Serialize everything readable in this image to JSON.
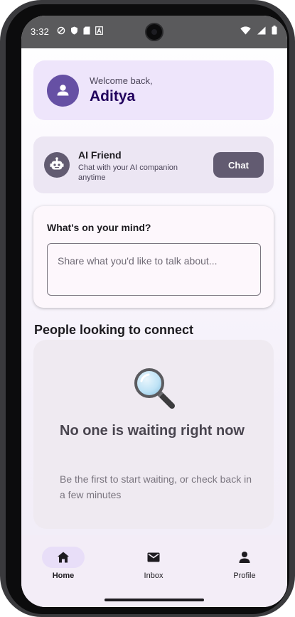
{
  "status_bar": {
    "time": "3:32"
  },
  "welcome": {
    "subtitle": "Welcome back,",
    "name": "Aditya",
    "avatar_icon": "person-icon"
  },
  "ai_friend": {
    "title": "AI Friend",
    "description": "Chat with your AI companion anytime",
    "button_label": "Chat",
    "icon": "robot-face-icon"
  },
  "mind": {
    "title": "What's on your mind?",
    "placeholder": "Share what you'd like to talk about...",
    "value": ""
  },
  "people": {
    "heading": "People looking to connect",
    "empty_icon": "magnifying-glass-icon",
    "empty_title": "No one is waiting right now",
    "empty_description": "Be the first to start waiting, or check back in a few minutes"
  },
  "nav": {
    "items": [
      {
        "label": "Home",
        "icon": "home-icon",
        "active": true
      },
      {
        "label": "Inbox",
        "icon": "mail-icon",
        "active": false
      },
      {
        "label": "Profile",
        "icon": "person-icon",
        "active": false
      }
    ]
  },
  "colors": {
    "primary": "#6650a4",
    "secondary": "#625b71",
    "welcome_card_bg": "#eee5fb",
    "ai_card_bg": "#ece6f3",
    "nav_bg": "#f3edf7",
    "nav_active_pill": "#e8def8"
  }
}
